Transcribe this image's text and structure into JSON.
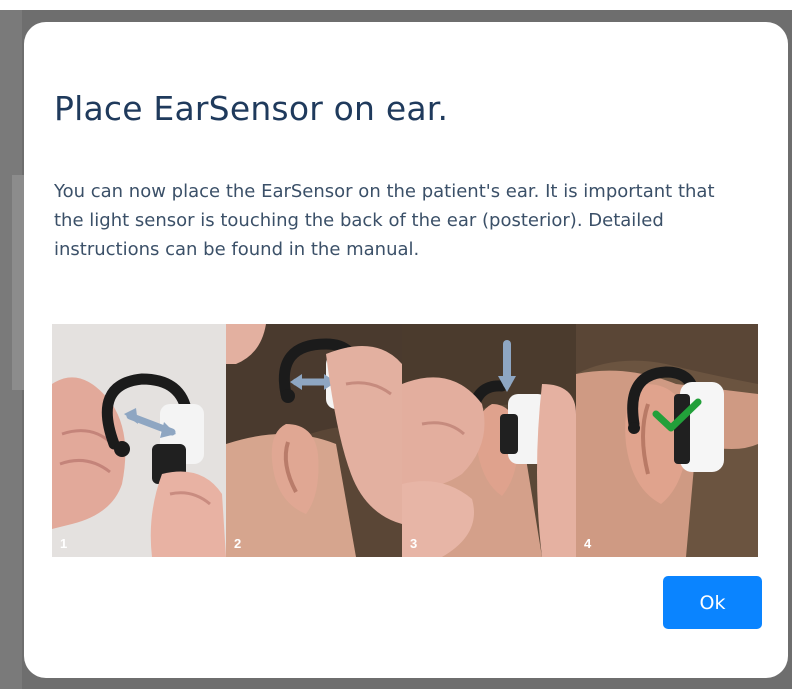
{
  "dialog": {
    "title": "Place EarSensor on ear.",
    "body": "You can now place the EarSensor on the patient's ear. It is important that the light sensor is touching the back of the ear (posterior). Detailed instructions can be found in the manual.",
    "steps": [
      {
        "number": "1"
      },
      {
        "number": "2"
      },
      {
        "number": "3"
      },
      {
        "number": "4"
      }
    ],
    "ok_label": "Ok"
  },
  "colors": {
    "title": "#1f3a5c",
    "body_text": "#3b5068",
    "button": "#0a84ff",
    "checkmark": "#22a03a"
  }
}
